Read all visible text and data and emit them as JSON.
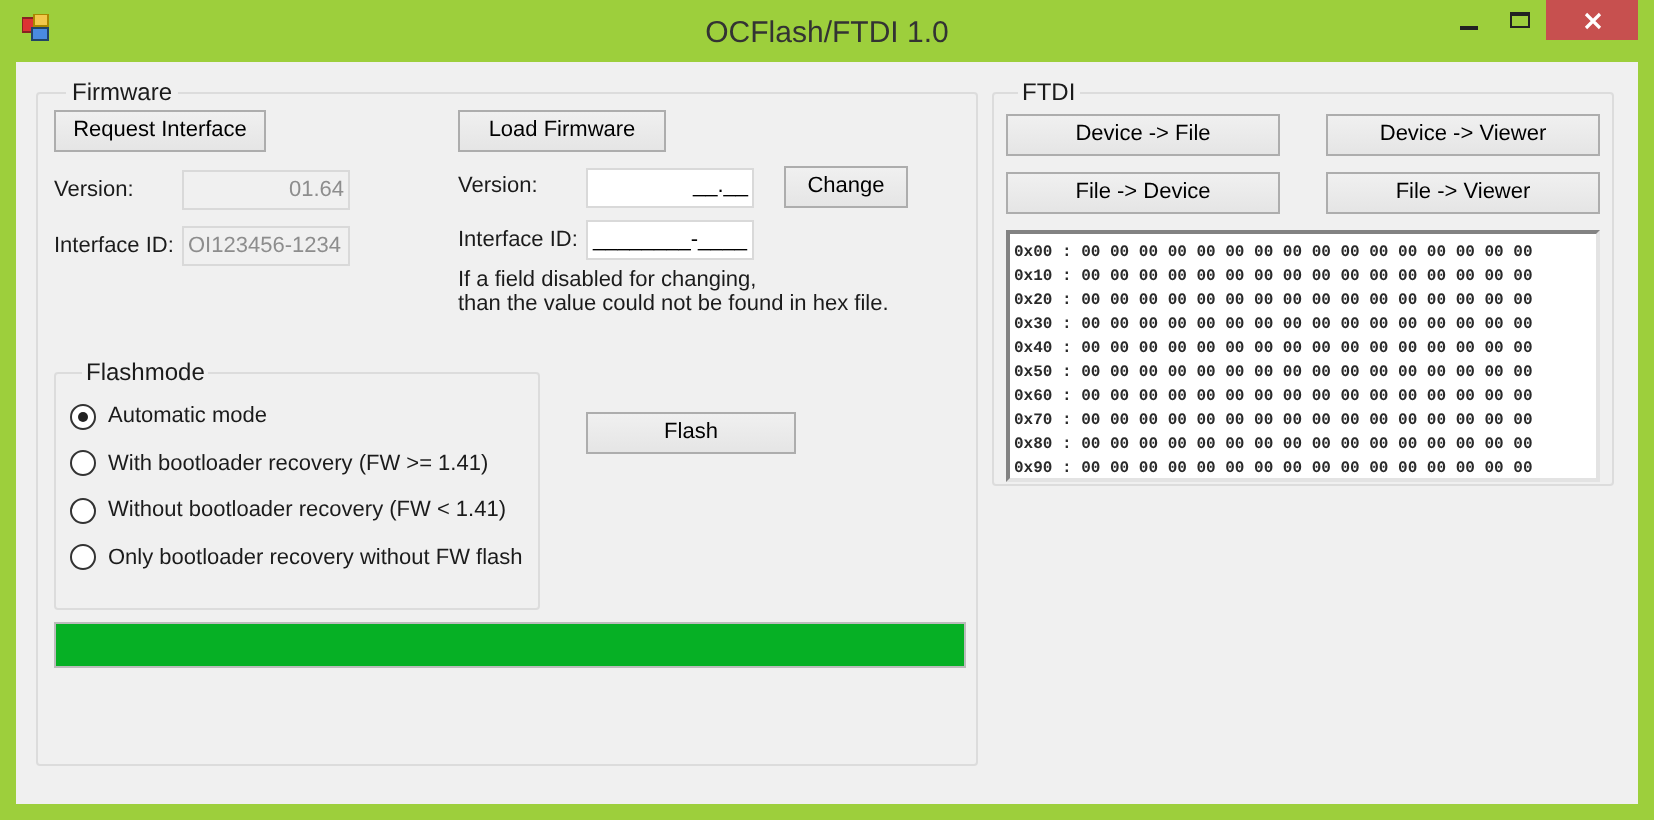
{
  "window": {
    "title": "OCFlash/FTDI 1.0"
  },
  "firmware": {
    "title": "Firmware",
    "request_button": "Request Interface",
    "load_button": "Load Firmware",
    "current": [
      {
        "label": "Version:",
        "value": "01.64",
        "disabled": true
      },
      {
        "label": "Interface ID:",
        "value": "OI123456-1234",
        "disabled": true
      }
    ],
    "file": [
      {
        "label": "Version:",
        "value": "__.__",
        "disabled": false
      },
      {
        "label": "Interface ID:",
        "value": "________-____",
        "disabled": false
      }
    ],
    "change_button": "Change",
    "note": "If a field disabled for changing,\nthan the value could not be found in hex file.",
    "flashmode": {
      "title": "Flashmode",
      "options": [
        {
          "label": "Automatic mode",
          "selected": true
        },
        {
          "label": "With bootloader recovery (FW >= 1.41)",
          "selected": false
        },
        {
          "label": "Without bootloader recovery (FW < 1.41)",
          "selected": false
        },
        {
          "label": "Only bootloader recovery without FW flash",
          "selected": false
        }
      ]
    },
    "flash_button": "Flash",
    "progress": {
      "level": 1
    }
  },
  "ftdi": {
    "title": "FTDI",
    "buttons": [
      "Device -> File",
      "Device -> Viewer",
      "File -> Device",
      "File -> Viewer"
    ],
    "hex_rows": [
      "0x00 : 00 00 00 00 00 00 00 00 00 00 00 00 00 00 00 00",
      "0x10 : 00 00 00 00 00 00 00 00 00 00 00 00 00 00 00 00",
      "0x20 : 00 00 00 00 00 00 00 00 00 00 00 00 00 00 00 00",
      "0x30 : 00 00 00 00 00 00 00 00 00 00 00 00 00 00 00 00",
      "0x40 : 00 00 00 00 00 00 00 00 00 00 00 00 00 00 00 00",
      "0x50 : 00 00 00 00 00 00 00 00 00 00 00 00 00 00 00 00",
      "0x60 : 00 00 00 00 00 00 00 00 00 00 00 00 00 00 00 00",
      "0x70 : 00 00 00 00 00 00 00 00 00 00 00 00 00 00 00 00",
      "0x80 : 00 00 00 00 00 00 00 00 00 00 00 00 00 00 00 00",
      "0x90 : 00 00 00 00 00 00 00 00 00 00 00 00 00 00 00 00"
    ]
  }
}
